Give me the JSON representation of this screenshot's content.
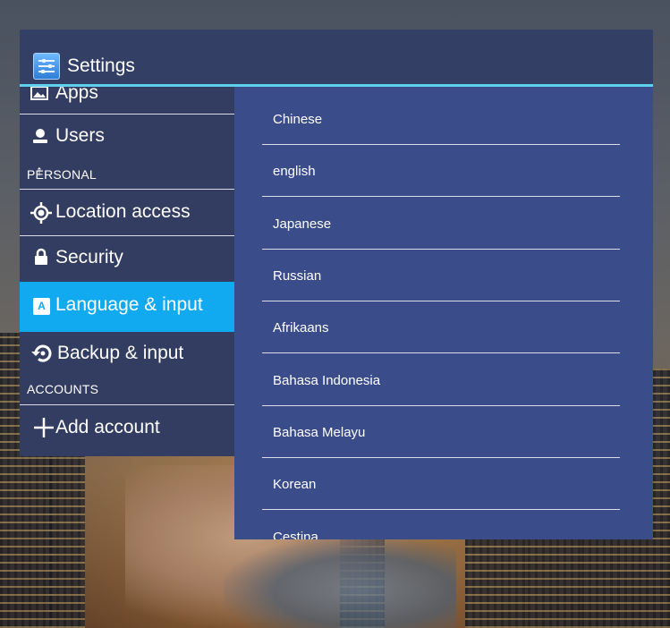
{
  "window": {
    "title": "Settings",
    "icon": "settings-sliders-icon"
  },
  "sidebar": {
    "items": [
      {
        "label": "Apps",
        "icon": "image-icon"
      },
      {
        "label": "Users",
        "icon": "user-icon"
      },
      {
        "label": "Location access",
        "icon": "location-target-icon"
      },
      {
        "label": "Security",
        "icon": "lock-icon"
      },
      {
        "label": "Language & input",
        "icon": "letter-a-icon",
        "selected": true
      },
      {
        "label": "Backup & input",
        "icon": "backup-restore-icon"
      },
      {
        "label": "Add account",
        "icon": "plus-icon"
      }
    ],
    "sections": {
      "personal": "PERSONAL",
      "personal_overlap_glyph": "↑",
      "accounts": "ACCOUNTS"
    }
  },
  "languages": [
    "Chinese",
    "english",
    "Japanese",
    "Russian",
    "Afrikaans",
    "Bahasa Indonesia",
    "Bahasa Melayu",
    "Korean",
    "Cestina"
  ],
  "colors": {
    "titlebar": "#343f66",
    "accent_line": "#5fd0ee",
    "sidebar_bg": "#333d62",
    "selected_item": "#11aaf1",
    "list_bg": "#3b4c8a"
  }
}
